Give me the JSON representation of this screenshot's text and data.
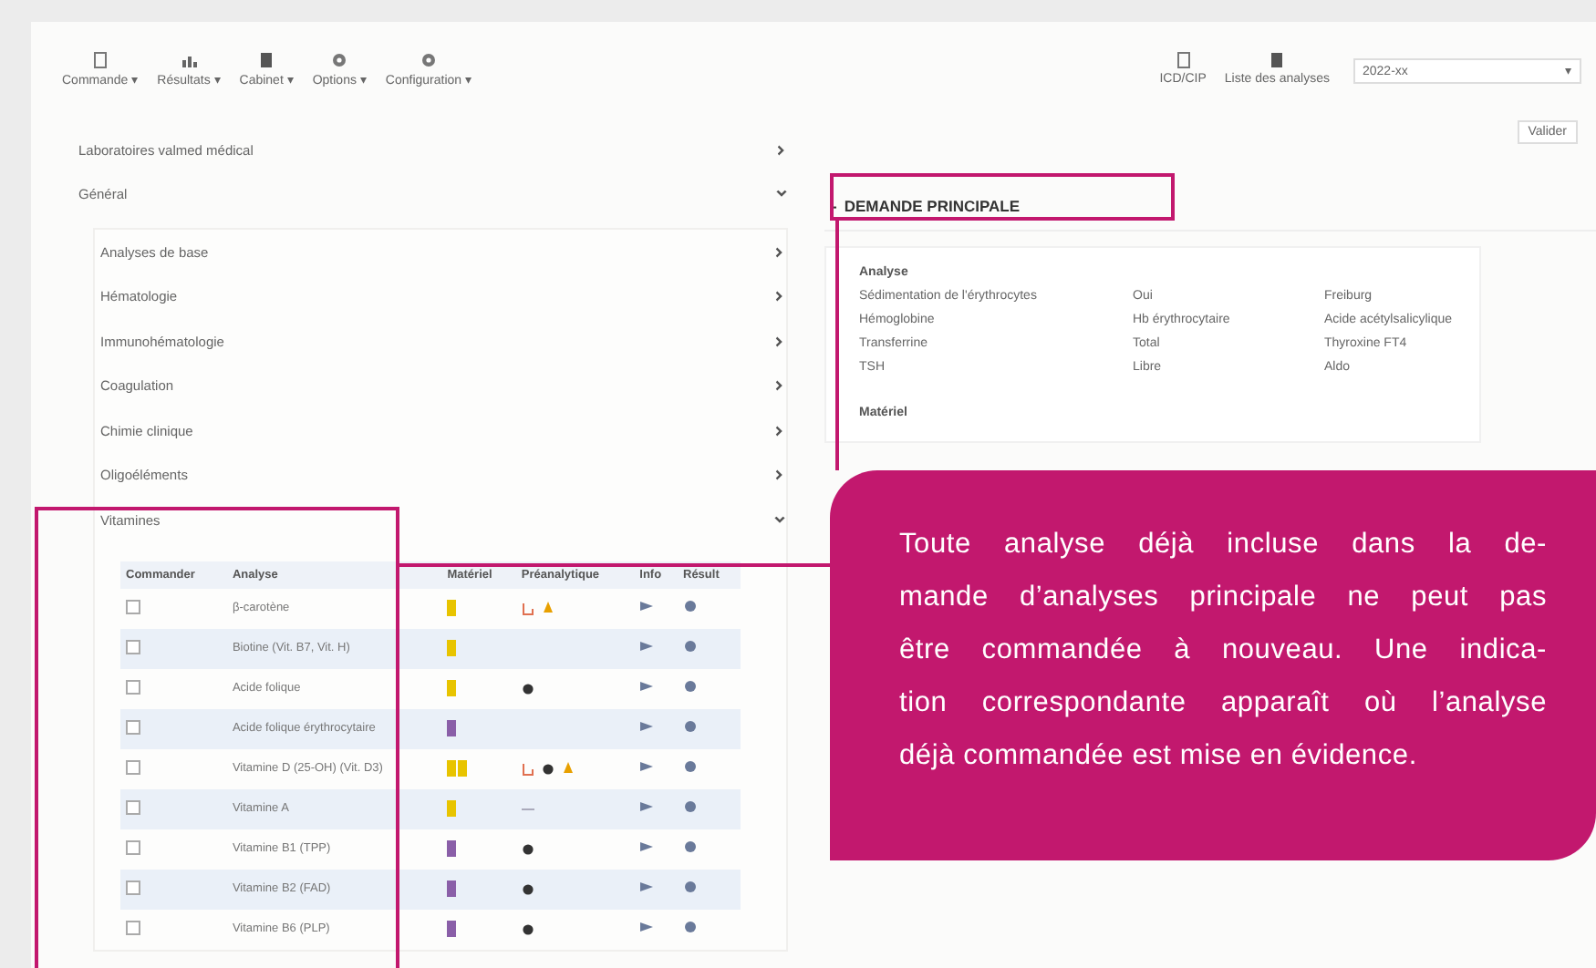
{
  "toolbar": {
    "buttons": [
      {
        "label": "Commande ▾",
        "kind": "doc"
      },
      {
        "label": "Résultats ▾",
        "kind": "chart"
      },
      {
        "label": "Cabinet ▾",
        "kind": "box"
      },
      {
        "label": "Options ▾",
        "kind": "gear"
      },
      {
        "label": "Configuration ▾",
        "kind": "gear"
      }
    ],
    "right_buttons": [
      {
        "label": "ICD/CIP",
        "kind": "doc"
      },
      {
        "label": "Liste des analyses",
        "kind": "box"
      }
    ],
    "select": {
      "value": "2022-xx",
      "caret": "▾"
    },
    "confirm": "Valider"
  },
  "nav": [
    {
      "label": "Laboratoires valmed médical",
      "expanded": false
    },
    {
      "label": "Général",
      "expanded": true,
      "children": [
        {
          "label": "Analyses de base",
          "expanded": false
        },
        {
          "label": "Hématologie",
          "expanded": false
        },
        {
          "label": "Immunohématologie",
          "expanded": false
        },
        {
          "label": "Coagulation",
          "expanded": false
        },
        {
          "label": "Chimie clinique",
          "expanded": false
        },
        {
          "label": "Oligoéléments",
          "expanded": false
        },
        {
          "label": "Vitamines",
          "expanded": true
        }
      ]
    }
  ],
  "table": {
    "columns": [
      "Commander",
      "Analyse",
      "Matériel",
      "Préanalytique",
      "Info",
      "Résult"
    ],
    "rows": [
      {
        "checked": false,
        "name": "β-carotène",
        "material": [
          {
            "color": "#e8c400"
          }
        ],
        "pre": [
          {
            "kind": "tube"
          },
          {
            "kind": "drop"
          }
        ]
      },
      {
        "checked": false,
        "name": "Biotine (Vit. B7, Vit. H)",
        "material": [
          {
            "color": "#e8c400"
          }
        ]
      },
      {
        "checked": false,
        "name": "Acide folique",
        "material": [
          {
            "color": "#e8c400"
          }
        ],
        "pre": [
          {
            "kind": "dot"
          }
        ]
      },
      {
        "checked": false,
        "name": "Acide folique érythrocytaire",
        "material": [
          {
            "color": "#8a5fa8"
          }
        ]
      },
      {
        "checked": false,
        "name": "Vitamine D (25-OH) (Vit. D3)",
        "material": [
          {
            "color": "#e8c400"
          },
          {
            "color": "#e8c400"
          }
        ],
        "pre": [
          {
            "kind": "tube"
          },
          {
            "kind": "dot"
          },
          {
            "kind": "drop"
          }
        ]
      },
      {
        "checked": false,
        "name": "Vitamine A",
        "material": [
          {
            "color": "#e8c400"
          }
        ],
        "pre": [
          {
            "kind": "dash"
          }
        ]
      },
      {
        "checked": false,
        "name": "Vitamine B1 (TPP)",
        "material": [
          {
            "color": "#8a5fa8"
          }
        ],
        "pre": [
          {
            "kind": "dot"
          }
        ]
      },
      {
        "checked": false,
        "name": "Vitamine B2 (FAD)",
        "material": [
          {
            "color": "#8a5fa8"
          }
        ],
        "pre": [
          {
            "kind": "dot"
          }
        ]
      },
      {
        "checked": false,
        "name": "Vitamine B6 (PLP)",
        "material": [
          {
            "color": "#8a5fa8"
          }
        ],
        "pre": [
          {
            "kind": "dot"
          }
        ]
      }
    ]
  },
  "request": {
    "title": "DEMANDE PRINCIPALE",
    "toggle": "-",
    "section": "Analyse",
    "rows": [
      [
        "Sédimentation de l'érythrocytes",
        "Oui",
        "Freiburg"
      ],
      [
        "Hémoglobine",
        "Hb érythrocytaire",
        "Acide acétylsalicylique"
      ],
      [
        "Transferrine",
        "Total",
        "Thyroxine FT4"
      ],
      [
        "TSH",
        "Libre",
        "Aldo"
      ]
    ],
    "section_2": "Matériel"
  },
  "callout": {
    "lines": [
      "Toute analyse déjà incluse dans la de-",
      "mande d’analyses principale ne peut pas",
      "être commandée à nouveau. Une indica-",
      "tion correspondante apparaît où l’analyse",
      "déjà commandée est mise en évidence."
    ]
  }
}
